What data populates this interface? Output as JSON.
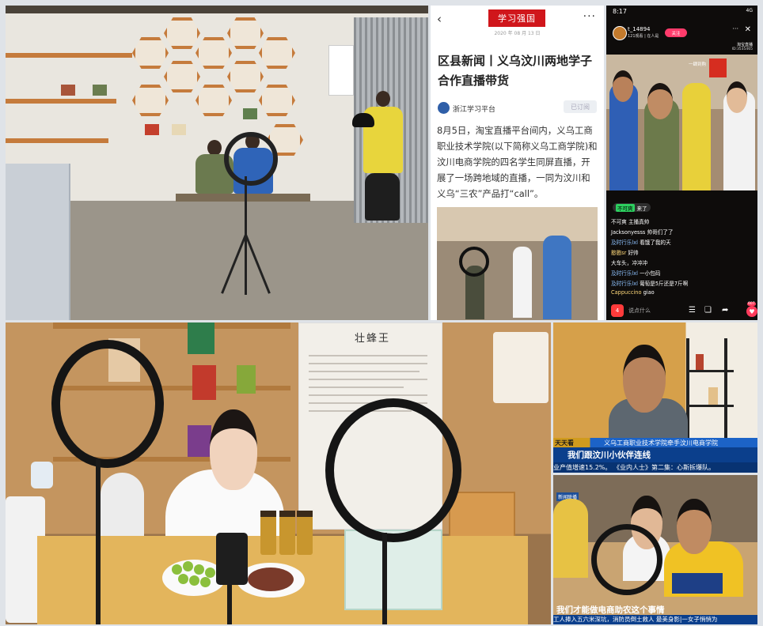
{
  "article": {
    "back_icon": "chevron-left-icon",
    "logo": "学习强国",
    "more": "···",
    "date": "2020 年 08 月 13 日",
    "headline": "区县新闻丨义乌汶川两地学子合作直播带货",
    "source": "浙江学习平台",
    "subscribe": "已订阅",
    "body": "8月5日，淘宝直播平台间内，义乌工商职业技术学院(以下简称义乌工商学院)和汶川电商学院的四名学生同屏直播，开展了一场跨地域的直播，一同为汶川和义乌“三农”产品打“call”。"
  },
  "live": {
    "time": "8:17",
    "signal": "4G",
    "host_name": "t_14894",
    "host_fans": "121观看 | 在人是",
    "follow": "关注",
    "right_label": "淘宝直播",
    "right_id": "ID:3535465",
    "scene_tag": "一肆到购",
    "gift_user": "不可爽",
    "gift_text": "来了",
    "comments": [
      {
        "user": "",
        "text": "不可爽 主播真帅",
        "color": "w"
      },
      {
        "user": "",
        "text": "Jacksonyesss 帅哥们了了",
        "color": "w"
      },
      {
        "user": "及时行乐lxl",
        "text": "看饿了我的天",
        "color": "u"
      },
      {
        "user": "憨憨sr",
        "text": "好帅",
        "color": "y"
      },
      {
        "user": "",
        "text": "大车头，冲冲冲",
        "color": "w"
      },
      {
        "user": "及时行乐lxl",
        "text": "一小包码",
        "color": "u"
      },
      {
        "user": "及时行乐lxl",
        "text": "葡萄是5斤还是7斤啊",
        "color": "u"
      },
      {
        "user": "Cappuccino",
        "text": "giao",
        "color": "y"
      }
    ],
    "bag_count": "4",
    "say_placeholder": "说点什么",
    "like_count": "607"
  },
  "sign": {
    "title": "壮蜂王"
  },
  "tv1": {
    "tag": "天天看",
    "headline": "义乌工商职业技术学院牵手汶川电商学院",
    "main": "我们跟汶川小伙伴连线",
    "ticker": "业产值增速15.2%。    《业内人士》第二集：心斯拆爆队。"
  },
  "tv2": {
    "badge": "新闻联播",
    "main": "我们才能做电商助农这个事情",
    "ticker": "工人捧入五六米深坑，消防员倒土救人      最美身影|一女子悄悄为"
  },
  "colors": {
    "xuexi_red": "#d0161b",
    "live_pink": "#ff3b6b",
    "tv_blue": "#0b3f8c",
    "shelf_orange": "#c57b3c"
  }
}
